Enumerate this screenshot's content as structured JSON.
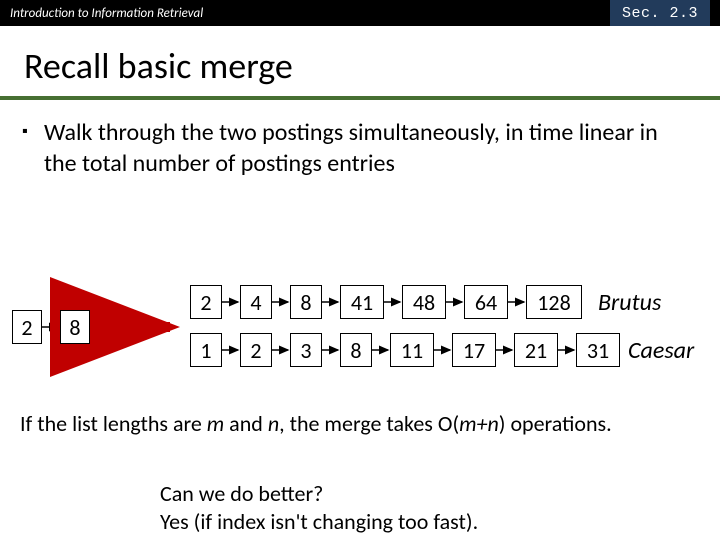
{
  "header": {
    "left": "Introduction to Information Retrieval",
    "section": "Sec. 2.3"
  },
  "title": "Recall basic merge",
  "bullet": "Walk through the two postings simultaneously, in time linear in the total number of postings entries",
  "left_pair": [
    "2",
    "8"
  ],
  "lists": {
    "brutus": {
      "label": "Brutus",
      "items": [
        "2",
        "4",
        "8",
        "41",
        "48",
        "64",
        "128"
      ]
    },
    "caesar": {
      "label": "Caesar",
      "items": [
        "1",
        "2",
        "3",
        "8",
        "11",
        "17",
        "21",
        "31"
      ]
    }
  },
  "footer_parts": {
    "a": "If the list lengths are ",
    "m": "m",
    "b": " and ",
    "n": "n",
    "c": ", the merge takes O(",
    "expr": "m+n",
    "d": ") operations."
  },
  "footer2_l1": "Can we do better?",
  "footer2_l2": "Yes (if index isn't changing too fast)."
}
